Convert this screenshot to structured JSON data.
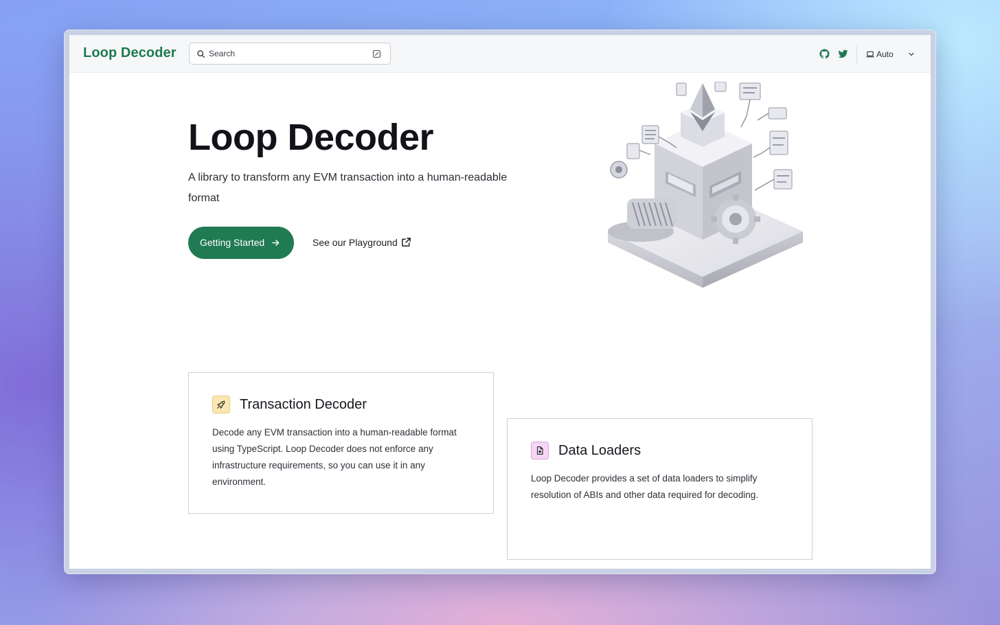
{
  "nav": {
    "logo": "Loop Decoder",
    "search_placeholder": "Search",
    "theme_label": "Auto"
  },
  "hero": {
    "title": "Loop Decoder",
    "subtitle": "A library to transform any EVM transaction into a human-readable format",
    "primary_button": "Getting Started",
    "secondary_link": "See our Playground"
  },
  "features": [
    {
      "title": "Transaction Decoder",
      "body": "Decode any EVM transaction into a human-readable format using TypeScript. Loop Decoder does not enforce any infrastructure requirements, so you can use it in any environment.",
      "icon": "rocket-icon"
    },
    {
      "title": "Data Loaders",
      "body": "Loop Decoder provides a set of data loaders to simplify resolution of ABIs and other data required for decoding.",
      "icon": "document-icon"
    }
  ],
  "colors": {
    "brand_green": "#207a52",
    "card1_icon_bg": "#fbe7b3",
    "card2_icon_bg": "#f6d6f5"
  }
}
